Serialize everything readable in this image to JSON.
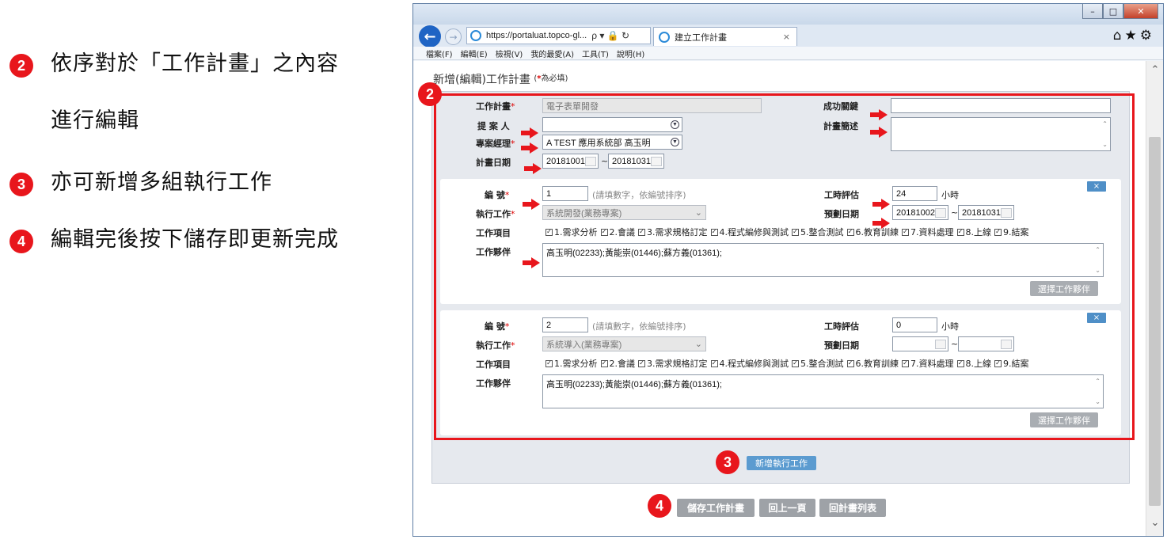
{
  "instructions": [
    {
      "num": "2",
      "text": "依序對於「工作計畫」之內容",
      "text2": "進行編輯"
    },
    {
      "num": "3",
      "text": "亦可新增多組執行工作"
    },
    {
      "num": "4",
      "text": "編輯完後按下儲存即更新完成"
    }
  ],
  "browser": {
    "url": "https://portaluat.topco-gl...",
    "url_controls": "ρ ▾ 🔒 ↻",
    "tab_title": "建立工作計畫",
    "tab_close": "×",
    "right_icons": "⌂★⚙",
    "menu": [
      "檔案(F)",
      "編輯(E)",
      "檢視(V)",
      "我的最愛(A)",
      "工具(T)",
      "說明(H)"
    ],
    "win_buttons": [
      "–",
      "□",
      "✕"
    ]
  },
  "page": {
    "title": "新增(編輯)工作計畫",
    "required_note_star": "*",
    "required_note": "為必填"
  },
  "plan": {
    "name_label": "工作計畫",
    "name_value": "電子表單開發",
    "proposer_label": "提 案 人",
    "proposer_value": "",
    "pm_label": "專案經理",
    "pm_value": "A TEST 應用系統部 高玉明",
    "date_label": "計畫日期",
    "date_start": "20181001",
    "date_end": "20181031",
    "date_sep": "~",
    "kpi_label": "成功關鍵",
    "kpi_value": "",
    "desc_label": "計畫簡述",
    "desc_value": "",
    "required_star": "*"
  },
  "tasks": [
    {
      "no_label": "編 號",
      "no_value": "1",
      "no_hint": "(請填數字，依編號排序)",
      "task_label": "執行工作",
      "task_value": "系統開發(業務專案)",
      "items_label": "工作項目",
      "items": [
        "1.需求分析",
        "2.會議",
        "3.需求規格訂定",
        "4.程式編修與測試",
        "5.整合測試",
        "6.教育訓練",
        "7.資料處理",
        "8.上線",
        "9.結案"
      ],
      "partners_label": "工作夥伴",
      "partners_value": "高玉明(02233);黃能崇(01446);蘇方義(01361);",
      "hours_label": "工時評估",
      "hours_value": "24",
      "hours_unit": "小時",
      "date_label": "預劃日期",
      "date_start": "20181002",
      "date_end": "20181031",
      "select_partner_btn": "選擇工作夥伴",
      "remove_btn": "×"
    },
    {
      "no_label": "編 號",
      "no_value": "2",
      "no_hint": "(請填數字，依編號排序)",
      "task_label": "執行工作",
      "task_value": "系統導入(業務專案)",
      "items_label": "工作項目",
      "items": [
        "1.需求分析",
        "2.會議",
        "3.需求規格訂定",
        "4.程式編修與測試",
        "5.整合測試",
        "6.教育訓練",
        "7.資料處理",
        "8.上線",
        "9.結案"
      ],
      "partners_label": "工作夥伴",
      "partners_value": "高玉明(02233);黃能崇(01446);蘇方義(01361);",
      "hours_label": "工時評估",
      "hours_value": "0",
      "hours_unit": "小時",
      "date_label": "預劃日期",
      "date_start": "",
      "date_end": "",
      "select_partner_btn": "選擇工作夥伴",
      "remove_btn": "×"
    }
  ],
  "actions": {
    "add_task": "新增執行工作",
    "save": "儲存工作計畫",
    "back": "回上一頁",
    "list": "回計畫列表"
  },
  "annotation_badges": {
    "frame": "2",
    "add": "3",
    "save": "4"
  },
  "colors": {
    "accent_red": "#e8161c",
    "button_blue": "#5b9bd0",
    "button_gray": "#9ea2a7"
  }
}
